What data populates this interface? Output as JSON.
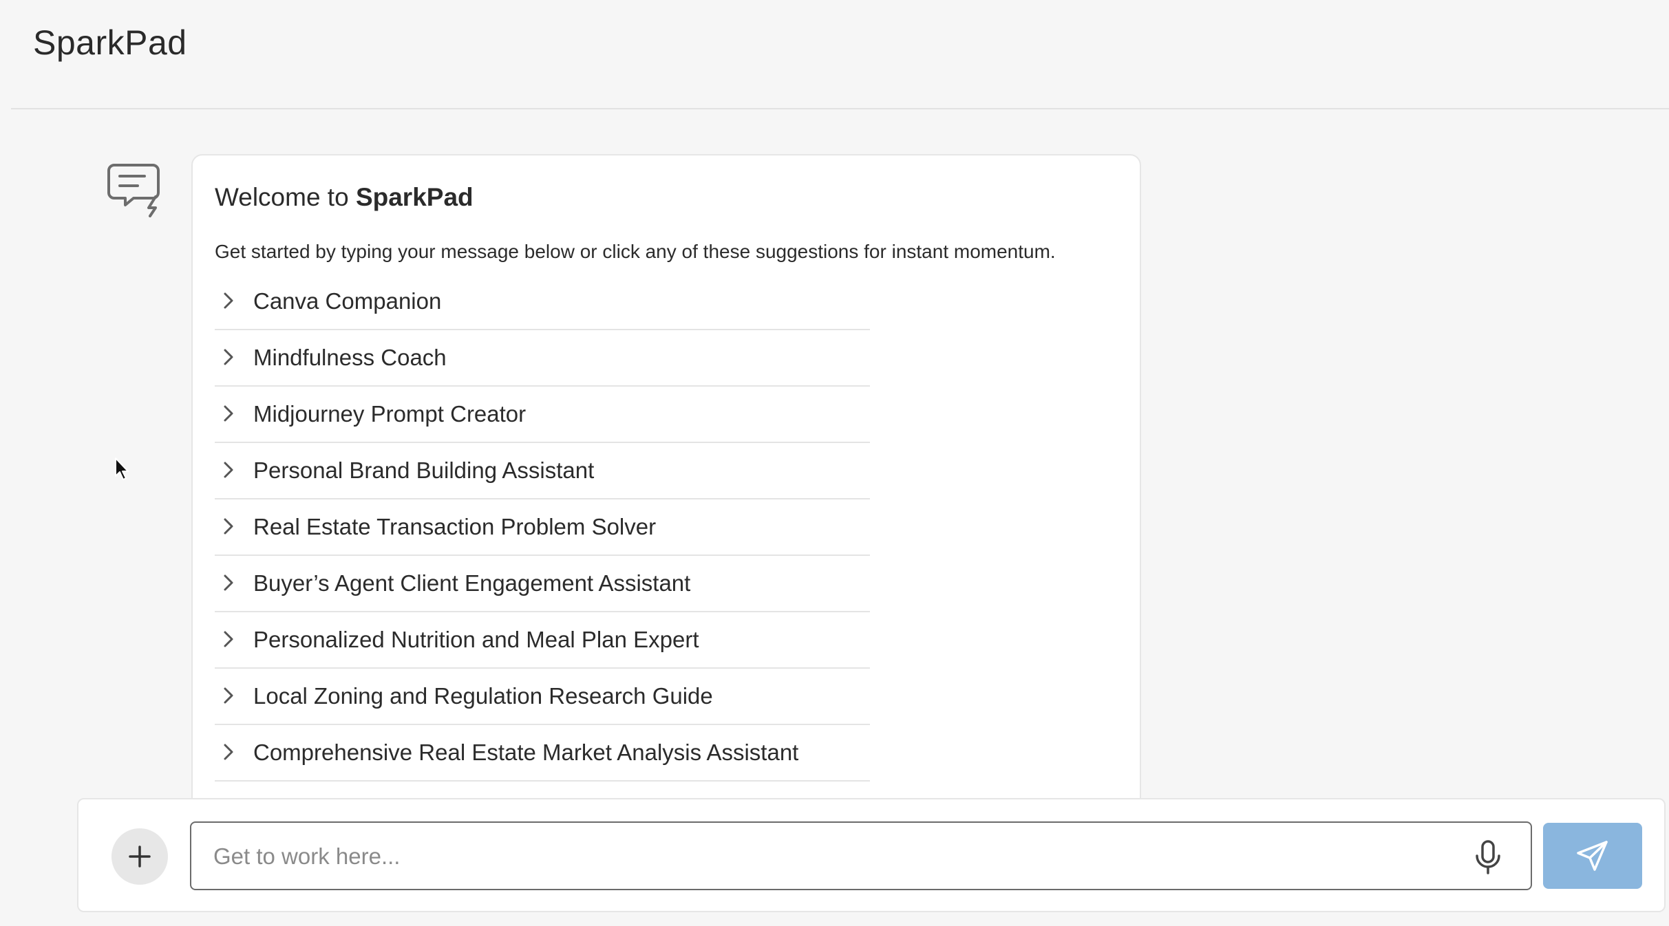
{
  "app": {
    "title": "SparkPad"
  },
  "welcome": {
    "title_prefix": "Welcome to ",
    "title_brand": "SparkPad",
    "subtitle": "Get started by typing your message below or click any of these suggestions for instant momentum."
  },
  "suggestions": [
    {
      "label": "Canva Companion"
    },
    {
      "label": "Mindfulness Coach"
    },
    {
      "label": "Midjourney Prompt Creator"
    },
    {
      "label": "Personal Brand Building Assistant"
    },
    {
      "label": "Real Estate Transaction Problem Solver"
    },
    {
      "label": "Buyer’s Agent Client Engagement Assistant"
    },
    {
      "label": "Personalized Nutrition and Meal Plan Expert"
    },
    {
      "label": "Local Zoning and Regulation Research Guide"
    },
    {
      "label": "Comprehensive Real Estate Market Analysis Assistant"
    }
  ],
  "composer": {
    "placeholder": "Get to work here...",
    "value": ""
  },
  "icons": {
    "assistant": "chat-bolt-icon",
    "suggestion_chevron": "chevron-right-icon",
    "attach": "plus-icon",
    "mic": "microphone-icon",
    "send": "paper-plane-icon"
  },
  "colors": {
    "page_background": "#f6f6f6",
    "card_background": "#ffffff",
    "send_button": "#8ab6de",
    "attach_button": "#e7e7e7",
    "text": "#2b2b2b",
    "placeholder": "#8a8a8a"
  }
}
